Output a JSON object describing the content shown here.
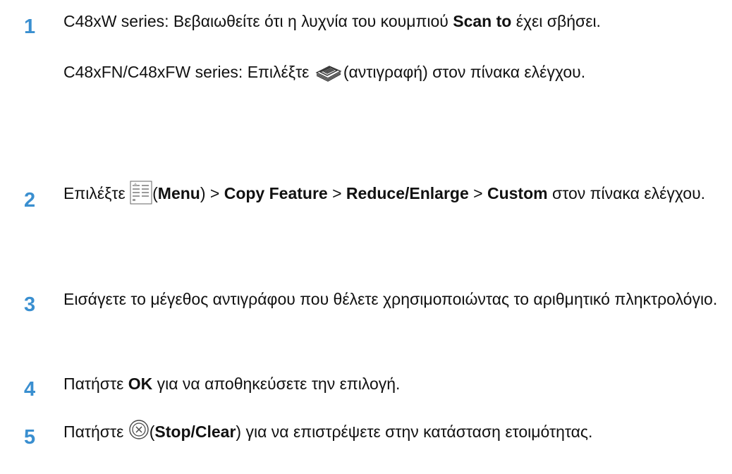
{
  "steps": [
    {
      "number": "1",
      "line1_pre": "C48xW series: Βεβαιωθείτε ότι η λυχνία του κουμπιού ",
      "line1_bold": "Scan to",
      "line1_post": " έχει σβήσει.",
      "line2_pre": "C48xFN/C48xFW series: Επιλέξτε ",
      "line2_icon": "copy-icon",
      "line2_post": "(αντιγραφή) στον πίνακα ελέγχου."
    },
    {
      "number": "2",
      "pre": "Επιλέξτε ",
      "icon": "menu-icon",
      "paren_open": "(",
      "menu_label": "Menu",
      "paren_close": ") > ",
      "copy_feature": "Copy Feature",
      "sep1": " > ",
      "reduce_enlarge": "Reduce/Enlarge",
      "sep2": " > ",
      "custom": "Custom",
      "post": " στον πίνακα ελέγχου."
    },
    {
      "number": "3",
      "text": "Εισάγετε το μέγεθος αντιγράφου που θέλετε χρησιμοποιώντας το αριθμητικό πληκτρολόγιο."
    },
    {
      "number": "4",
      "pre": "Πατήστε ",
      "bold": "OK",
      "post": " για να αποθηκεύσετε την επιλογή."
    },
    {
      "number": "5",
      "pre": "Πατήστε ",
      "icon": "stop-clear-icon",
      "paren_open": "(",
      "bold": "Stop/Clear",
      "post": ") για να επιστρέψετε στην κατάσταση ετοιμότητας."
    }
  ],
  "colors": {
    "step_number": "#3a8fd0",
    "text": "#111111"
  }
}
